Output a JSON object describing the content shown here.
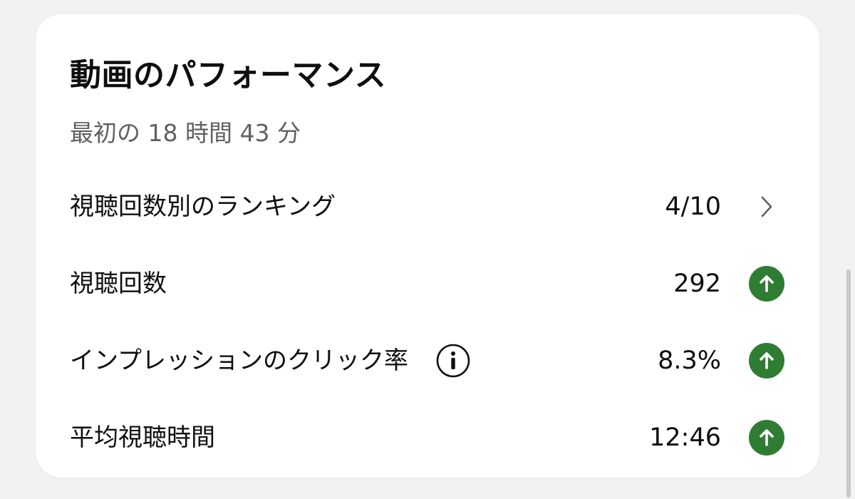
{
  "card": {
    "title": "動画のパフォーマンス",
    "subtitle": "最初の 18 時間 43 分"
  },
  "metrics": [
    {
      "label": "視聴回数別のランキング",
      "value": "4/10",
      "trailing": "chevron-right-icon"
    },
    {
      "label": "視聴回数",
      "value": "292",
      "trailing": "arrow-up-circle-icon"
    },
    {
      "label": "インプレッションのクリック率",
      "value": "8.3%",
      "trailing": "arrow-up-circle-icon",
      "has_info": true
    },
    {
      "label": "平均視聴時間",
      "value": "12:46",
      "trailing": "arrow-up-circle-icon"
    }
  ],
  "colors": {
    "up_indicator": "#2e7d32",
    "secondary_text": "#606060",
    "card_background": "#ffffff",
    "page_background": "#f2f2f2"
  }
}
